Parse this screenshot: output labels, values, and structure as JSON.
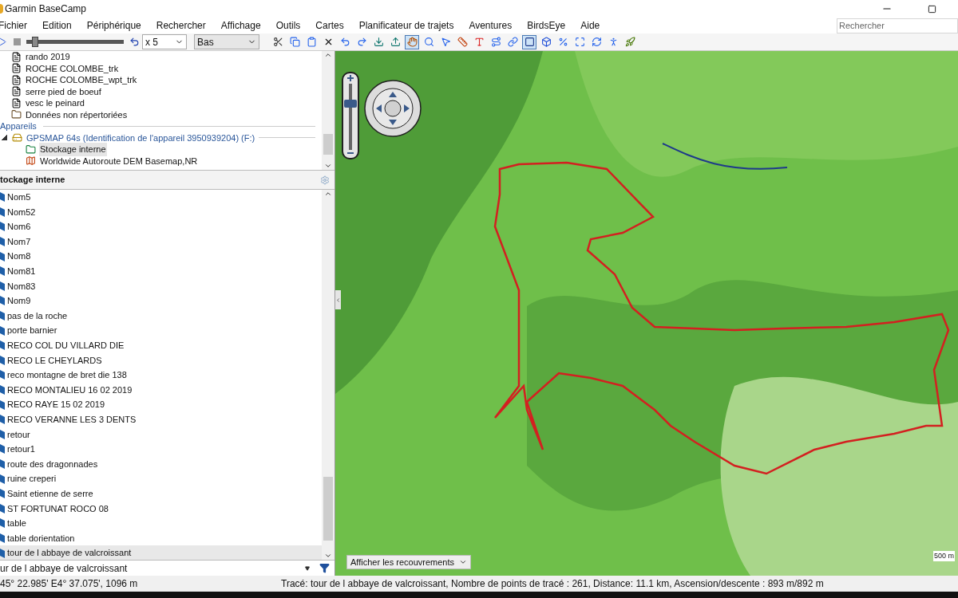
{
  "window": {
    "title": "Garmin BaseCamp"
  },
  "menu": [
    "Fichier",
    "Edition",
    "Périphérique",
    "Rechercher",
    "Affichage",
    "Outils",
    "Cartes",
    "Planificateur de trajets",
    "Aventures",
    "BirdsEye",
    "Aide"
  ],
  "search": {
    "placeholder": "Rechercher"
  },
  "toolbar": {
    "playback": {
      "level": 0.06
    },
    "speed": "x 5",
    "quality": "Bas",
    "tools": [
      {
        "kind": "cut",
        "selected": false
      },
      {
        "kind": "copy",
        "selected": false
      },
      {
        "kind": "paste",
        "selected": false
      },
      {
        "kind": "delete",
        "selected": false
      },
      {
        "kind": "undo",
        "selected": false
      },
      {
        "kind": "redo",
        "selected": false
      },
      {
        "kind": "receive",
        "selected": false
      },
      {
        "kind": "send",
        "selected": false
      },
      {
        "kind": "hand",
        "selected": true
      },
      {
        "kind": "zoom",
        "selected": false
      },
      {
        "kind": "pointer",
        "selected": false
      },
      {
        "kind": "ruler",
        "selected": false
      },
      {
        "kind": "waypoint",
        "selected": false
      },
      {
        "kind": "route",
        "selected": false
      },
      {
        "kind": "link",
        "selected": false
      },
      {
        "kind": "map2d",
        "selected": true
      },
      {
        "kind": "map3d",
        "selected": false
      },
      {
        "kind": "percent",
        "selected": false
      },
      {
        "kind": "fit",
        "selected": false
      },
      {
        "kind": "sync",
        "selected": false
      },
      {
        "kind": "profile",
        "selected": false
      },
      {
        "kind": "rocket",
        "selected": false
      }
    ]
  },
  "tree": {
    "items": [
      {
        "kind": "file",
        "label": "rando 2019",
        "selected": false
      },
      {
        "kind": "file",
        "label": "ROCHE COLOMBE_trk",
        "selected": false
      },
      {
        "kind": "file",
        "label": "ROCHE COLOMBE_wpt_trk",
        "selected": false
      },
      {
        "kind": "file",
        "label": "serre pied de boeuf",
        "selected": false
      },
      {
        "kind": "file",
        "label": "vesc le peinard",
        "selected": false
      },
      {
        "kind": "folder",
        "label": "Données non répertoriées",
        "selected": false
      },
      {
        "kind": "section",
        "label": "Appareils"
      },
      {
        "kind": "device",
        "label": "GPSMAP 64s (Identification de l'appareil 3950939204) (F:)",
        "expanded": true,
        "children": [
          {
            "kind": "storage",
            "label": "Stockage interne",
            "selected": true
          },
          {
            "kind": "map",
            "label": "Worldwide Autoroute DEM Basemap,NR",
            "selected": false
          }
        ]
      }
    ]
  },
  "list": {
    "title": "tockage interne",
    "items": [
      {
        "label": "Nom5",
        "selected": false
      },
      {
        "label": "Nom52",
        "selected": false
      },
      {
        "label": "Nom6",
        "selected": false
      },
      {
        "label": "Nom7",
        "selected": false
      },
      {
        "label": "Nom8",
        "selected": false
      },
      {
        "label": "Nom81",
        "selected": false
      },
      {
        "label": "Nom83",
        "selected": false
      },
      {
        "label": "Nom9",
        "selected": false
      },
      {
        "label": "pas de la roche",
        "selected": false
      },
      {
        "label": "porte barnier",
        "selected": false
      },
      {
        "label": "RECO COL DU VILLARD DIE",
        "selected": false
      },
      {
        "label": "RECO LE CHEYLARDS",
        "selected": false
      },
      {
        "label": "reco montagne de bret die 138",
        "selected": false
      },
      {
        "label": "RECO MONTALIEU 16 02 2019",
        "selected": false
      },
      {
        "label": "RECO RAYE 15 02 2019",
        "selected": false
      },
      {
        "label": "RECO VERANNE LES 3 DENTS",
        "selected": false
      },
      {
        "label": "retour",
        "selected": false
      },
      {
        "label": "retour1",
        "selected": false
      },
      {
        "label": "route des dragonnades",
        "selected": false
      },
      {
        "label": "ruine creperi",
        "selected": false
      },
      {
        "label": "Saint etienne de serre",
        "selected": false
      },
      {
        "label": "ST FORTUNAT ROCO 08",
        "selected": false
      },
      {
        "label": "table",
        "selected": false
      },
      {
        "label": "table dorientation",
        "selected": false
      },
      {
        "label": "tour de l abbaye de valcroissant",
        "selected": true
      }
    ]
  },
  "filter": {
    "value": "ur de l abbaye de valcroissant"
  },
  "map": {
    "zoom": {
      "level": 0.72
    },
    "overlays": "Afficher les recouvrements",
    "scale": "500 m"
  },
  "status_bar": {
    "position": "45° 22.985' E4° 37.075', 1096 m",
    "info": "Tracé: tour de l abbaye de valcroissant, Nombre de points de tracé : 261, Distance: 11.1 km, Ascension/descente : 893 m/892 m"
  }
}
